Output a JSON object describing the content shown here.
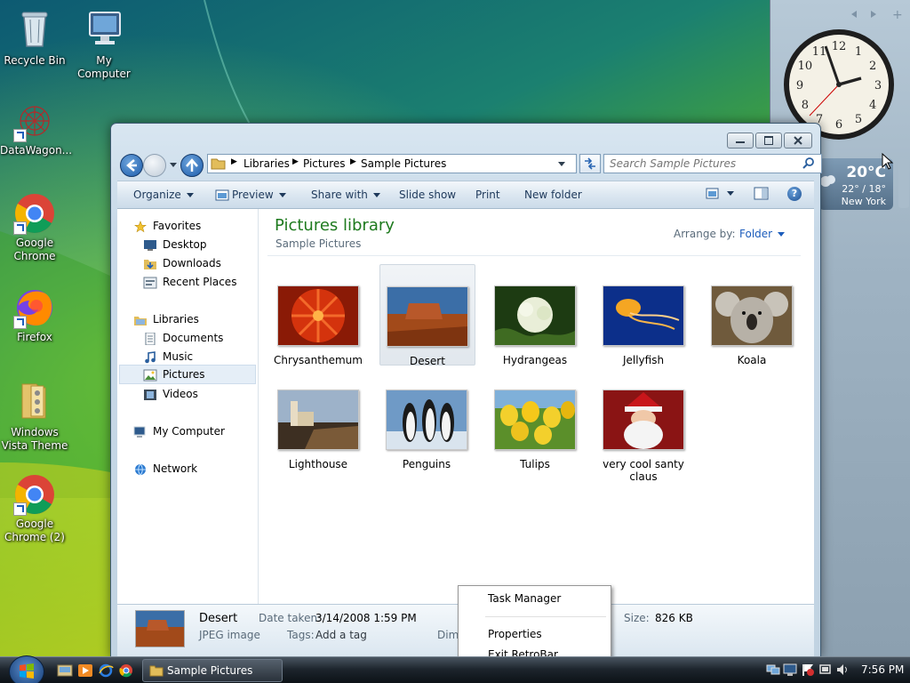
{
  "desktop": {
    "icons": [
      {
        "label": "Recycle Bin"
      },
      {
        "label": "My Computer"
      },
      {
        "label": "DataWagon..."
      },
      {
        "label": "Google Chrome"
      },
      {
        "label": "Firefox"
      },
      {
        "label": "Windows Vista Theme"
      },
      {
        "label": "Google Chrome (2)"
      }
    ]
  },
  "gadgets": {
    "clock": {
      "numerals": [
        "12",
        "1",
        "2",
        "3",
        "4",
        "5",
        "6",
        "7",
        "8",
        "9",
        "10",
        "11"
      ]
    },
    "weather": {
      "temp": "20°C",
      "range": "22° / 18°",
      "city": "New York"
    }
  },
  "window": {
    "address": {
      "crumbs": [
        "Libraries",
        "Pictures",
        "Sample Pictures"
      ]
    },
    "search": {
      "placeholder": "Search Sample Pictures"
    },
    "commands": {
      "organize": "Organize",
      "preview": "Preview",
      "share": "Share with",
      "slideshow": "Slide show",
      "print": "Print",
      "newfolder": "New folder"
    },
    "nav": {
      "favorites": "Favorites",
      "desktop": "Desktop",
      "downloads": "Downloads",
      "recent": "Recent Places",
      "libraries": "Libraries",
      "documents": "Documents",
      "music": "Music",
      "pictures": "Pictures",
      "videos": "Videos",
      "computer": "My Computer",
      "network": "Network"
    },
    "library": {
      "title": "Pictures library",
      "subtitle": "Sample Pictures",
      "arrange_label": "Arrange by:",
      "arrange_value": "Folder"
    },
    "items": [
      {
        "name": "Chrysanthemum"
      },
      {
        "name": "Desert"
      },
      {
        "name": "Hydrangeas"
      },
      {
        "name": "Jellyfish"
      },
      {
        "name": "Koala"
      },
      {
        "name": "Lighthouse"
      },
      {
        "name": "Penguins"
      },
      {
        "name": "Tulips"
      },
      {
        "name": "very cool santy claus"
      }
    ],
    "details": {
      "name": "Desert",
      "type": "JPEG image",
      "date_label": "Date taken:",
      "date_value": "3/14/2008 1:59 PM",
      "tags_label": "Tags:",
      "tags_value": "Add a tag",
      "dim_label": "Dim",
      "size_label": "Size:",
      "size_value": "826 KB"
    }
  },
  "context_menu": {
    "items": [
      "Task Manager",
      "Properties",
      "Exit RetroBar"
    ]
  },
  "taskbar": {
    "task_label": "Sample Pictures",
    "time": "7:56 PM"
  }
}
